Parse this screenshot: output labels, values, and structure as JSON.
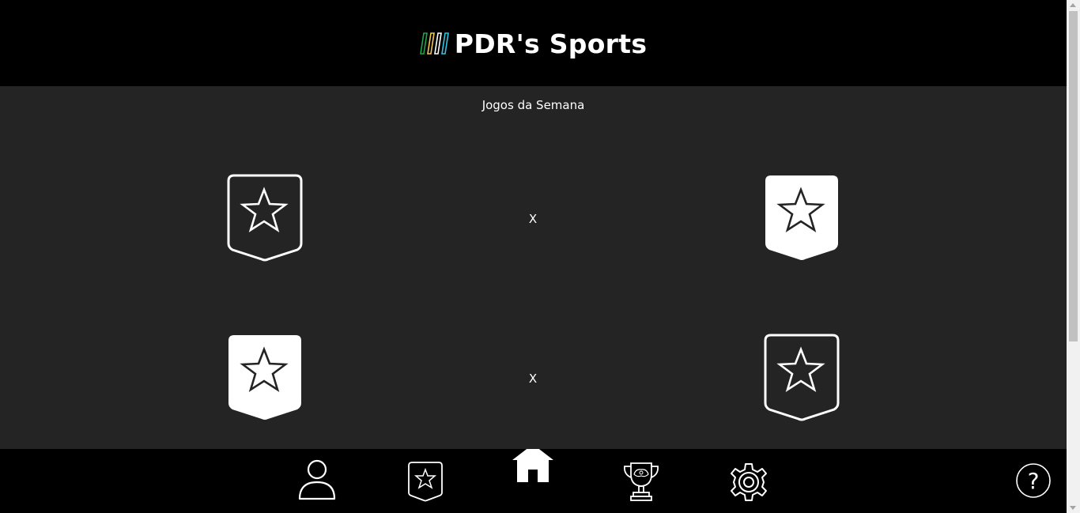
{
  "header": {
    "title": "PDR's Sports",
    "logo_icon": "stripes-logo-icon",
    "logo_colors": [
      "#1fa64a",
      "#f2c94c",
      "#ffffff",
      "#2ec4e6"
    ]
  },
  "main": {
    "section_title": "Jogos da Semana",
    "matches": [
      {
        "home_icon": "shield-star-outline-icon",
        "versus": "X",
        "away_icon": "shield-star-filled-icon"
      },
      {
        "home_icon": "shield-star-filled-icon",
        "versus": "X",
        "away_icon": "shield-star-outline-icon"
      }
    ]
  },
  "nav": {
    "items": [
      {
        "name": "profile",
        "icon": "user-icon"
      },
      {
        "name": "teams",
        "icon": "shield-star-icon"
      },
      {
        "name": "home",
        "icon": "home-icon",
        "active": true
      },
      {
        "name": "championships",
        "icon": "trophy-icon"
      },
      {
        "name": "settings",
        "icon": "gear-icon"
      }
    ],
    "help": {
      "icon": "help-icon",
      "label": "?"
    }
  },
  "colors": {
    "header_bg": "#000000",
    "page_bg": "#242424",
    "nav_bg": "#000000",
    "foreground": "#ffffff"
  }
}
